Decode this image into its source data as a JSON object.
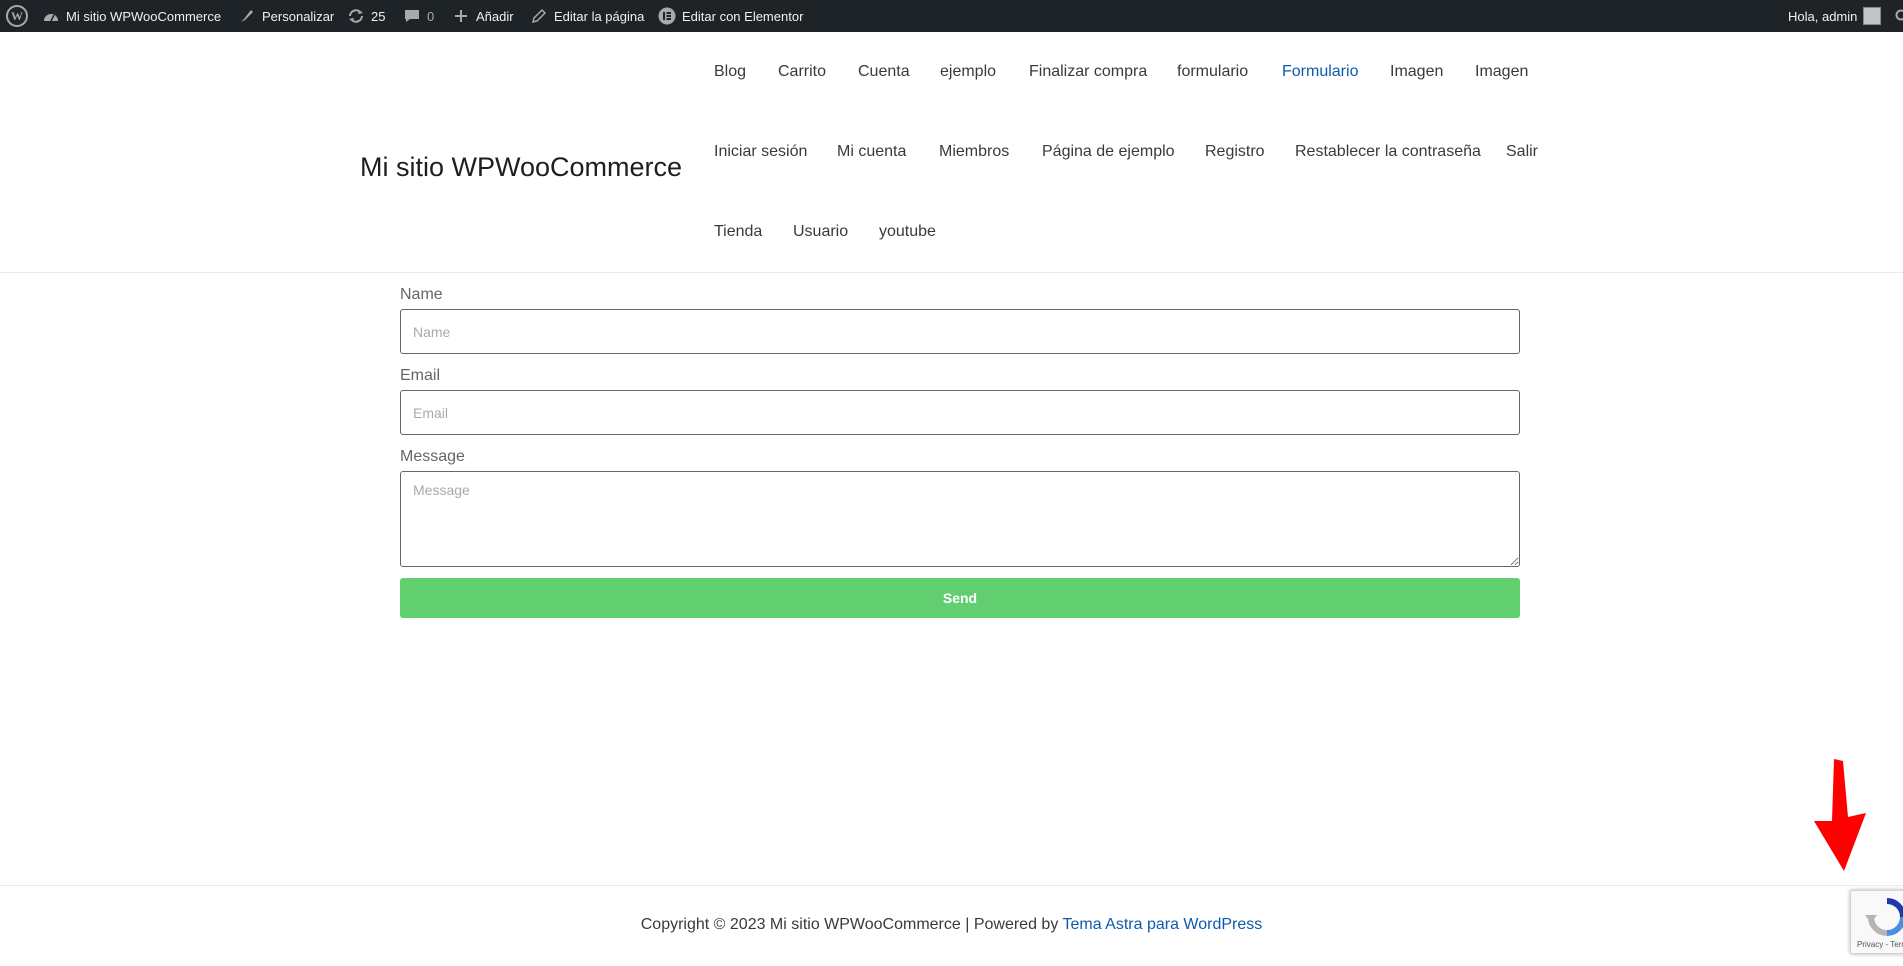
{
  "admin_bar": {
    "site_name": "Mi sitio WPWooCommerce",
    "customize": "Personalizar",
    "updates_count": "25",
    "comments_count": "0",
    "add_new": "Añadir",
    "edit_page": "Editar la página",
    "edit_elementor": "Editar con Elementor",
    "greeting": "Hola, admin"
  },
  "header": {
    "site_title": "Mi sitio WPWooCommerce",
    "nav": [
      "Blog",
      "Carrito",
      "Cuenta",
      "ejemplo",
      "Finalizar compra",
      "formulario",
      "Formulario",
      "Imagen",
      "Imagen",
      "Iniciar sesión",
      "Mi cuenta",
      "Miembros",
      "Página de ejemplo",
      "Registro",
      "Restablecer la contraseña",
      "Salir",
      "Tienda",
      "Usuario",
      "youtube"
    ],
    "active_item": "Formulario"
  },
  "form": {
    "name_label": "Name",
    "name_placeholder": "Name",
    "email_label": "Email",
    "email_placeholder": "Email",
    "message_label": "Message",
    "message_placeholder": "Message",
    "send_label": "Send"
  },
  "footer": {
    "copyright": "Copyright © 2023 Mi sitio WPWooCommerce | Powered by ",
    "theme_link": "Tema Astra para WordPress"
  },
  "recaptcha": {
    "text": "Privacy - Terms"
  },
  "colors": {
    "admin_bar_bg": "#1d2327",
    "link": "#0d5bab",
    "send_button": "#61ce70",
    "annotation_arrow": "#ff0000"
  }
}
